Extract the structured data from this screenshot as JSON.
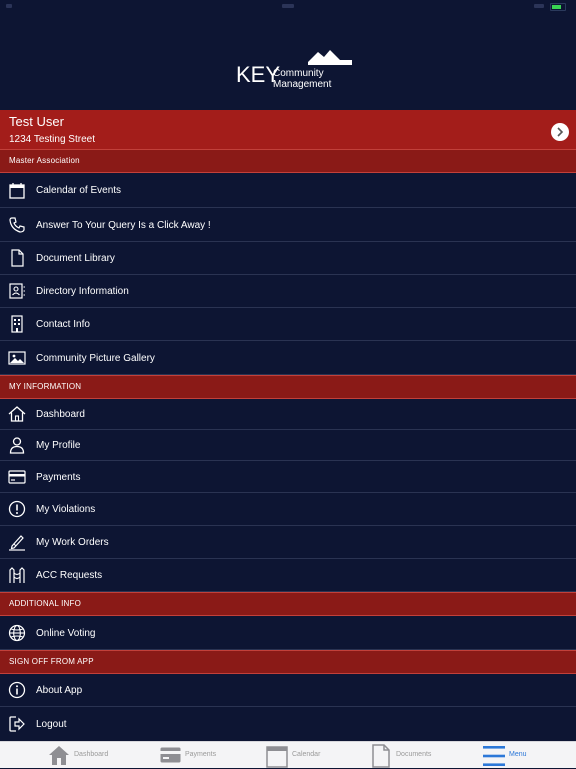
{
  "logo": {
    "text_main": "KEY",
    "text_line1": "Community",
    "text_line2": "Management"
  },
  "user": {
    "name": "Test User",
    "street": "1234 Testing Street"
  },
  "sections": {
    "master": {
      "title": "Master Association"
    },
    "my_info": {
      "title": "MY INFORMATION"
    },
    "additional": {
      "title": "ADDITIONAL INFO"
    },
    "signoff": {
      "title": "SIGN OFF FROM APP"
    }
  },
  "menu": {
    "calendar": "Calendar of Events",
    "query": "Answer To Your Query Is a Click Away !",
    "documents": "Document Library",
    "directory": "Directory Information",
    "contact": "Contact Info",
    "gallery": "Community Picture Gallery",
    "dashboard": "Dashboard",
    "profile": "My Profile",
    "payments": "Payments",
    "violations": "My Violations",
    "work_orders": "My Work Orders",
    "acc": "ACC Requests",
    "voting": "Online Voting",
    "about": "About App",
    "logout": "Logout"
  },
  "tabs": {
    "dashboard": "Dashboard",
    "payments": "Payments",
    "calendar": "Calendar",
    "documents": "Documents",
    "menu": "Menu"
  },
  "colors": {
    "background": "#0d1533",
    "accent_red": "#a31d1a",
    "tab_active": "#2c78d8"
  }
}
